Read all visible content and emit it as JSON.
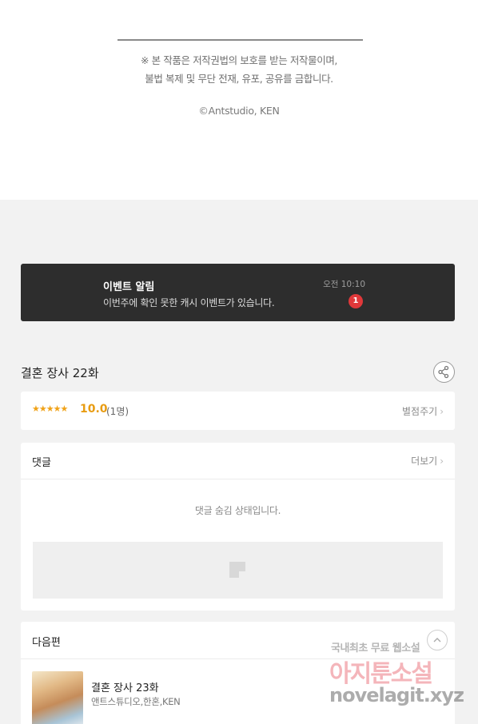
{
  "copyright_section": {
    "notice_line1": "※ 본 작품은 저작권법의 보호를 받는 저작물이며,",
    "notice_line2": "불법 복제 및 무단 전재, 유포, 공유를 금합니다.",
    "copyright": "©Antstudio, KEN"
  },
  "event_banner": {
    "title": "이벤트 알림",
    "message": "이번주에 확인 못한 캐시 이벤트가 있습니다.",
    "time": "오전 10:10",
    "badge_count": "1"
  },
  "episode": {
    "title": "결혼 장사 22화",
    "share_icon": "share-icon"
  },
  "rating": {
    "stars": "★★★★★",
    "stars_value": 5,
    "score": "10.0",
    "count": "(1명)",
    "rate_link": "별점주기"
  },
  "comments": {
    "label": "댓글",
    "more_link": "더보기",
    "hidden_message": "댓글 숨김 상태입니다."
  },
  "next_episode": {
    "label": "다음편",
    "title": "결혼 장사 23화",
    "authors": "앤트스튜디오,한혼,KEN"
  },
  "watermark": {
    "line1": "국내최초 무료 웹소설",
    "line2": "아지툰소설",
    "line3": "novelagit.xyz"
  },
  "colors": {
    "banner_bg": "#2d2d2d",
    "badge": "#e0383a",
    "rating_accent": "#e89c12"
  }
}
